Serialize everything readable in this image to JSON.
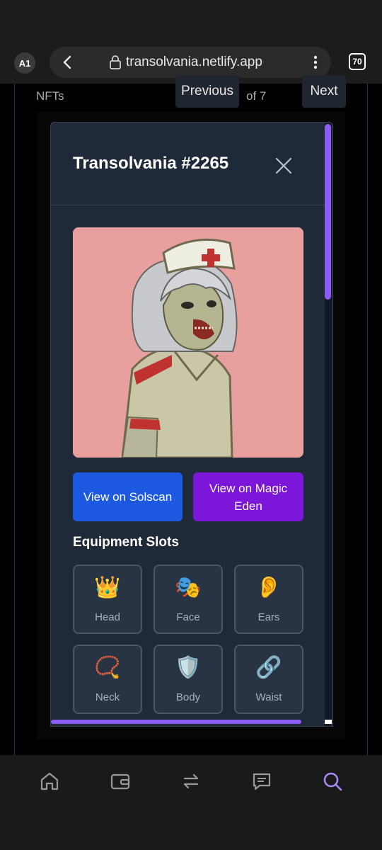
{
  "browser": {
    "profile_initials": "A1",
    "url": "transolvania.netlify.app",
    "tab_count": "70"
  },
  "page": {
    "nfts_label": "NFTs",
    "previous_label": "Previous",
    "page_info": "of 7",
    "next_label": "Next"
  },
  "modal": {
    "title": "Transolvania #2265",
    "solscan_label": "View on Solscan",
    "magic_eden_label": "View on Magic Eden",
    "equipment_title": "Equipment Slots",
    "slots": [
      {
        "label": "Head",
        "emoji": "👑"
      },
      {
        "label": "Face",
        "emoji": "🎭"
      },
      {
        "label": "Ears",
        "emoji": "👂"
      },
      {
        "label": "Neck",
        "emoji": "📿"
      },
      {
        "label": "Body",
        "emoji": "🛡️"
      },
      {
        "label": "Waist",
        "emoji": "🔗"
      }
    ]
  },
  "bottom_nav": {
    "items": [
      "home-icon",
      "wallet-icon",
      "swap-icon",
      "chat-icon",
      "search-icon"
    ],
    "active": "search-icon",
    "active_color": "#a78bfa"
  }
}
